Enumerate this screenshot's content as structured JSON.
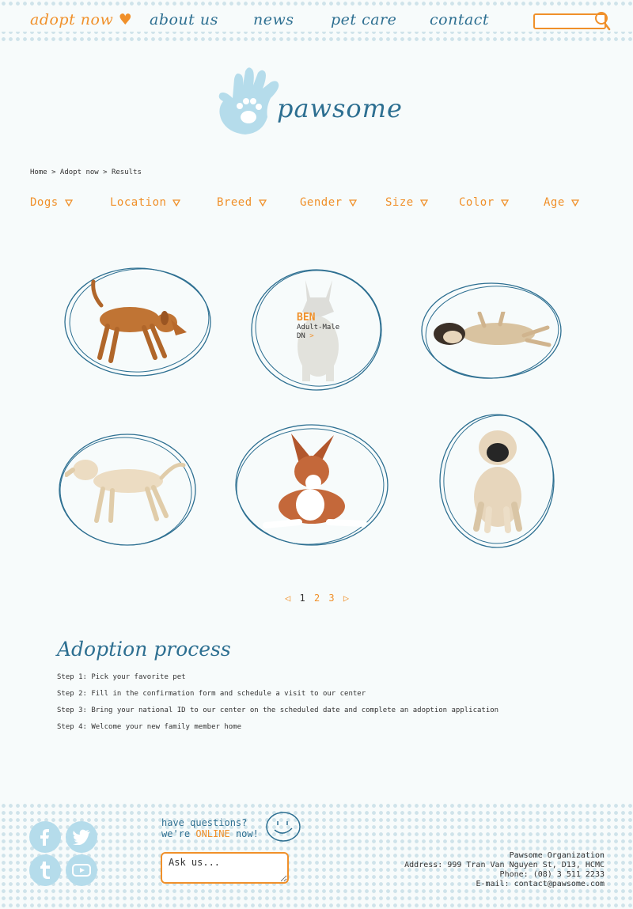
{
  "nav": {
    "adopt_now": "adopt now ♥",
    "about_us": "about us",
    "news": "news",
    "pet_care": "pet care",
    "contact": "contact"
  },
  "search": {
    "placeholder": ""
  },
  "logo": {
    "text": "pawsome"
  },
  "breadcrumb": "Home > Adopt now > Results",
  "filters": [
    "Dogs",
    "Location",
    "Breed",
    "Gender",
    "Size",
    "Color",
    "Age"
  ],
  "featured_pet": {
    "name": "BEN",
    "details": "Adult-Male",
    "location": "DN",
    "arrow": ">"
  },
  "pagination": {
    "prev": "◁",
    "pages": [
      "1",
      "2",
      "3"
    ],
    "current": "1",
    "next": "▷"
  },
  "adoption": {
    "title": "Adoption process",
    "steps": [
      "Step 1: Pick your favorite pet",
      "Step 2: Fill in the confirmation form and schedule a visit to our center",
      "Step 3: Bring your national ID to our center on the scheduled date and complete an adoption application",
      "Step 4: Welcome your new family member home"
    ]
  },
  "footer": {
    "question_line1": "have questions?",
    "question_line2_prefix": "we're ",
    "question_online": "ONLINE",
    "question_line2_suffix": " now!",
    "ask_placeholder": "Ask us...",
    "org": "Pawsome Organization",
    "address": "Address: 999 Tran Van Nguyen St, D13, HCMC",
    "phone": "Phone: (08) 3 511 2233",
    "email": "E-mail: contact@pawsome.com"
  },
  "social_icons": [
    "facebook-icon",
    "twitter-icon",
    "tumblr-icon",
    "youtube-icon"
  ],
  "colors": {
    "accent": "#f0902a",
    "brand_blue": "#2d6f91",
    "light_blue": "#b5dceb"
  }
}
